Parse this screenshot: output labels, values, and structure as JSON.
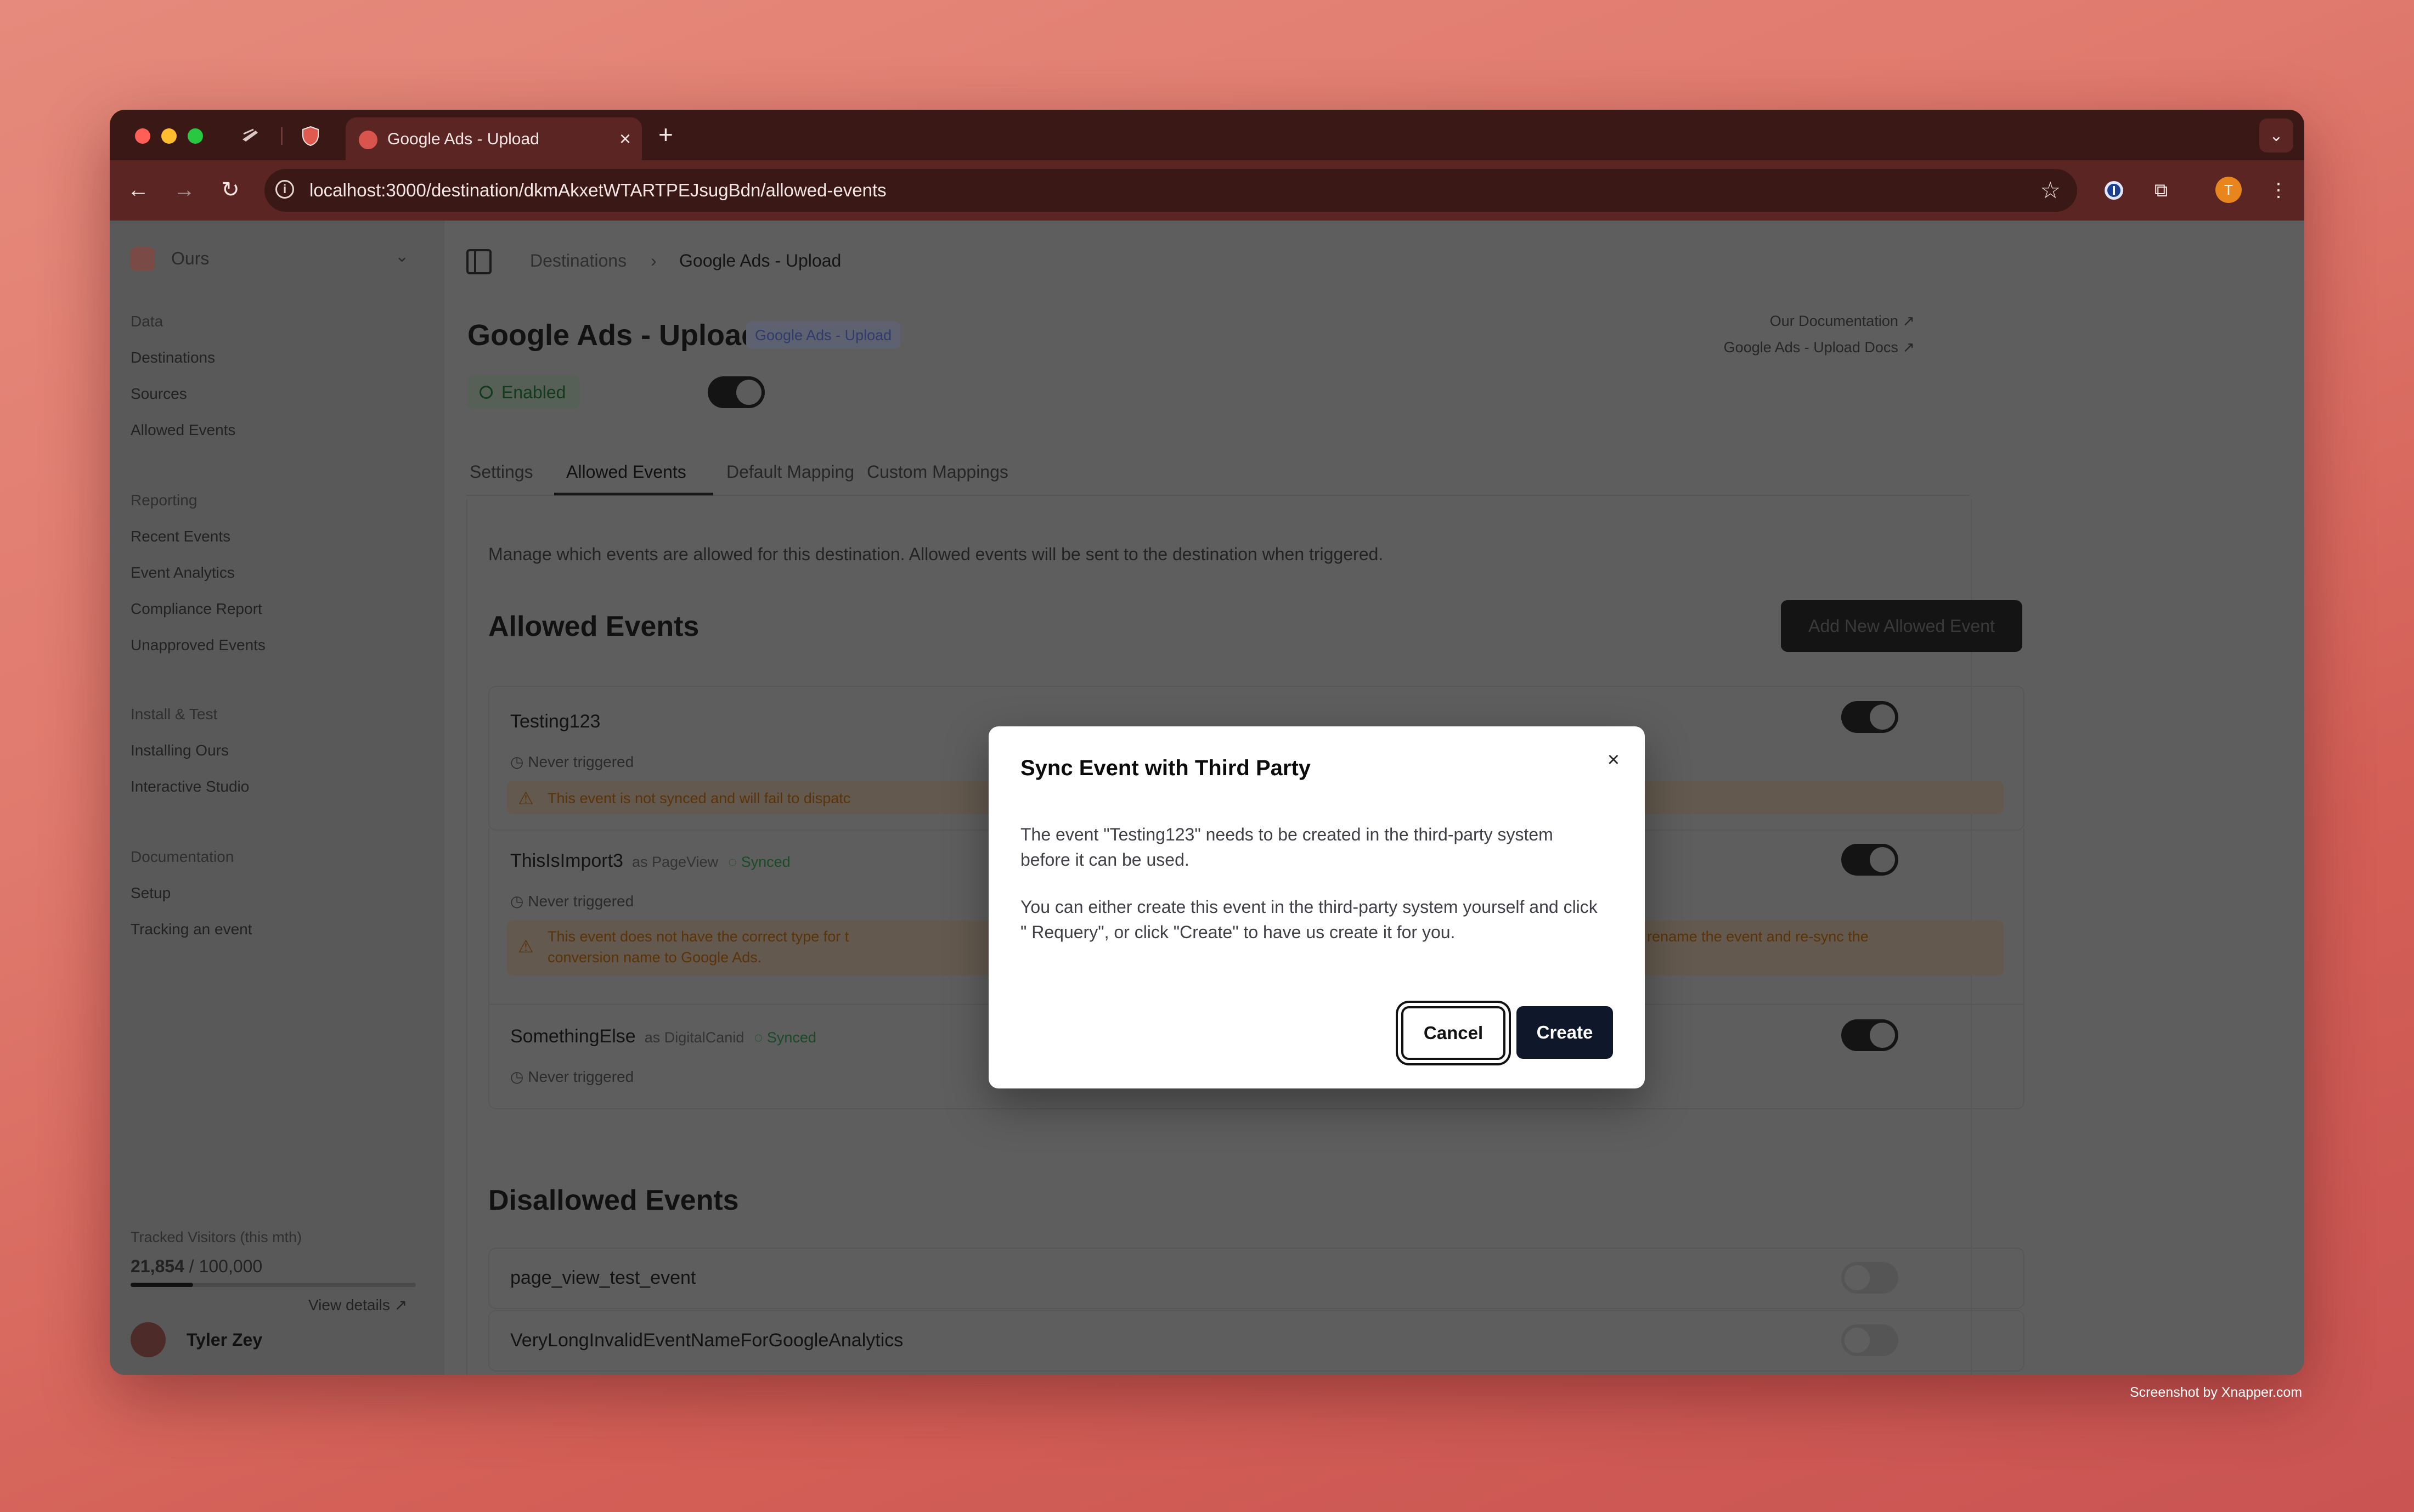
{
  "browser": {
    "tab_title": "Google Ads - Upload",
    "url": "localhost:3000/destination/dkmAkxetWTARTPEJsugBdn/allowed-events",
    "profile_initial": "T"
  },
  "sidebar": {
    "workspace": "Ours",
    "sections": [
      {
        "title": "Data",
        "items": [
          "Destinations",
          "Sources",
          "Allowed Events"
        ]
      },
      {
        "title": "Reporting",
        "items": [
          "Recent Events",
          "Event Analytics",
          "Compliance Report",
          "Unapproved Events"
        ]
      },
      {
        "title": "Install & Test",
        "items": [
          "Installing Ours",
          "Interactive Studio"
        ]
      },
      {
        "title": "Documentation",
        "items": [
          "Setup",
          "Tracking an event"
        ]
      }
    ],
    "usage": {
      "label": "Tracked Visitors (this mth)",
      "value": "21,854",
      "limit": "/ 100,000",
      "fraction": 0.2185
    },
    "view_details": "View details",
    "user_name": "Tyler Zey"
  },
  "breadcrumb": {
    "parent": "Destinations",
    "separator": "›",
    "current": "Google Ads - Upload"
  },
  "header": {
    "title": "Google Ads - Upload",
    "badge": "Google Ads - Upload",
    "status": "Enabled",
    "links": [
      "Our Documentation",
      "Google Ads - Upload Docs"
    ]
  },
  "tabs": [
    "Settings",
    "Allowed Events",
    "Default Mapping",
    "Custom Mappings"
  ],
  "main": {
    "description": "Manage which events are allowed for this destination. Allowed events will be sent to the destination when triggered.",
    "allowed_title": "Allowed Events",
    "add_button": "Add New Allowed Event",
    "events": [
      {
        "name": "Testing123",
        "never": "Never triggered",
        "warning": "This event is not synced and will fail to dispatc"
      },
      {
        "name": "ThisIsImport3",
        "as": "as PageView",
        "synced": "Synced",
        "never": "Never triggered",
        "warning_left": "This event does not have the correct type for t",
        "warning_left2": "conversion name to Google Ads.",
        "warning_right": "ease rename the event and re-sync the"
      },
      {
        "name": "SomethingElse",
        "as": "as DigitalCanid",
        "synced": "Synced",
        "never": "Never triggered"
      }
    ],
    "disallowed_title": "Disallowed Events",
    "disallowed": [
      "page_view_test_event",
      "VeryLongInvalidEventNameForGoogleAnalytics"
    ]
  },
  "modal": {
    "title": "Sync Event with Third Party",
    "p1": "The event \"Testing123\" needs to be created in the third-party system before it can be used.",
    "p2": "You can either create this event in the third-party system yourself and click \" Requery\", or click \"Create\" to have us create it for you.",
    "cancel": "Cancel",
    "create": "Create",
    "close_icon": "close-icon"
  },
  "watermark": "Screenshot by Xnapper.com"
}
